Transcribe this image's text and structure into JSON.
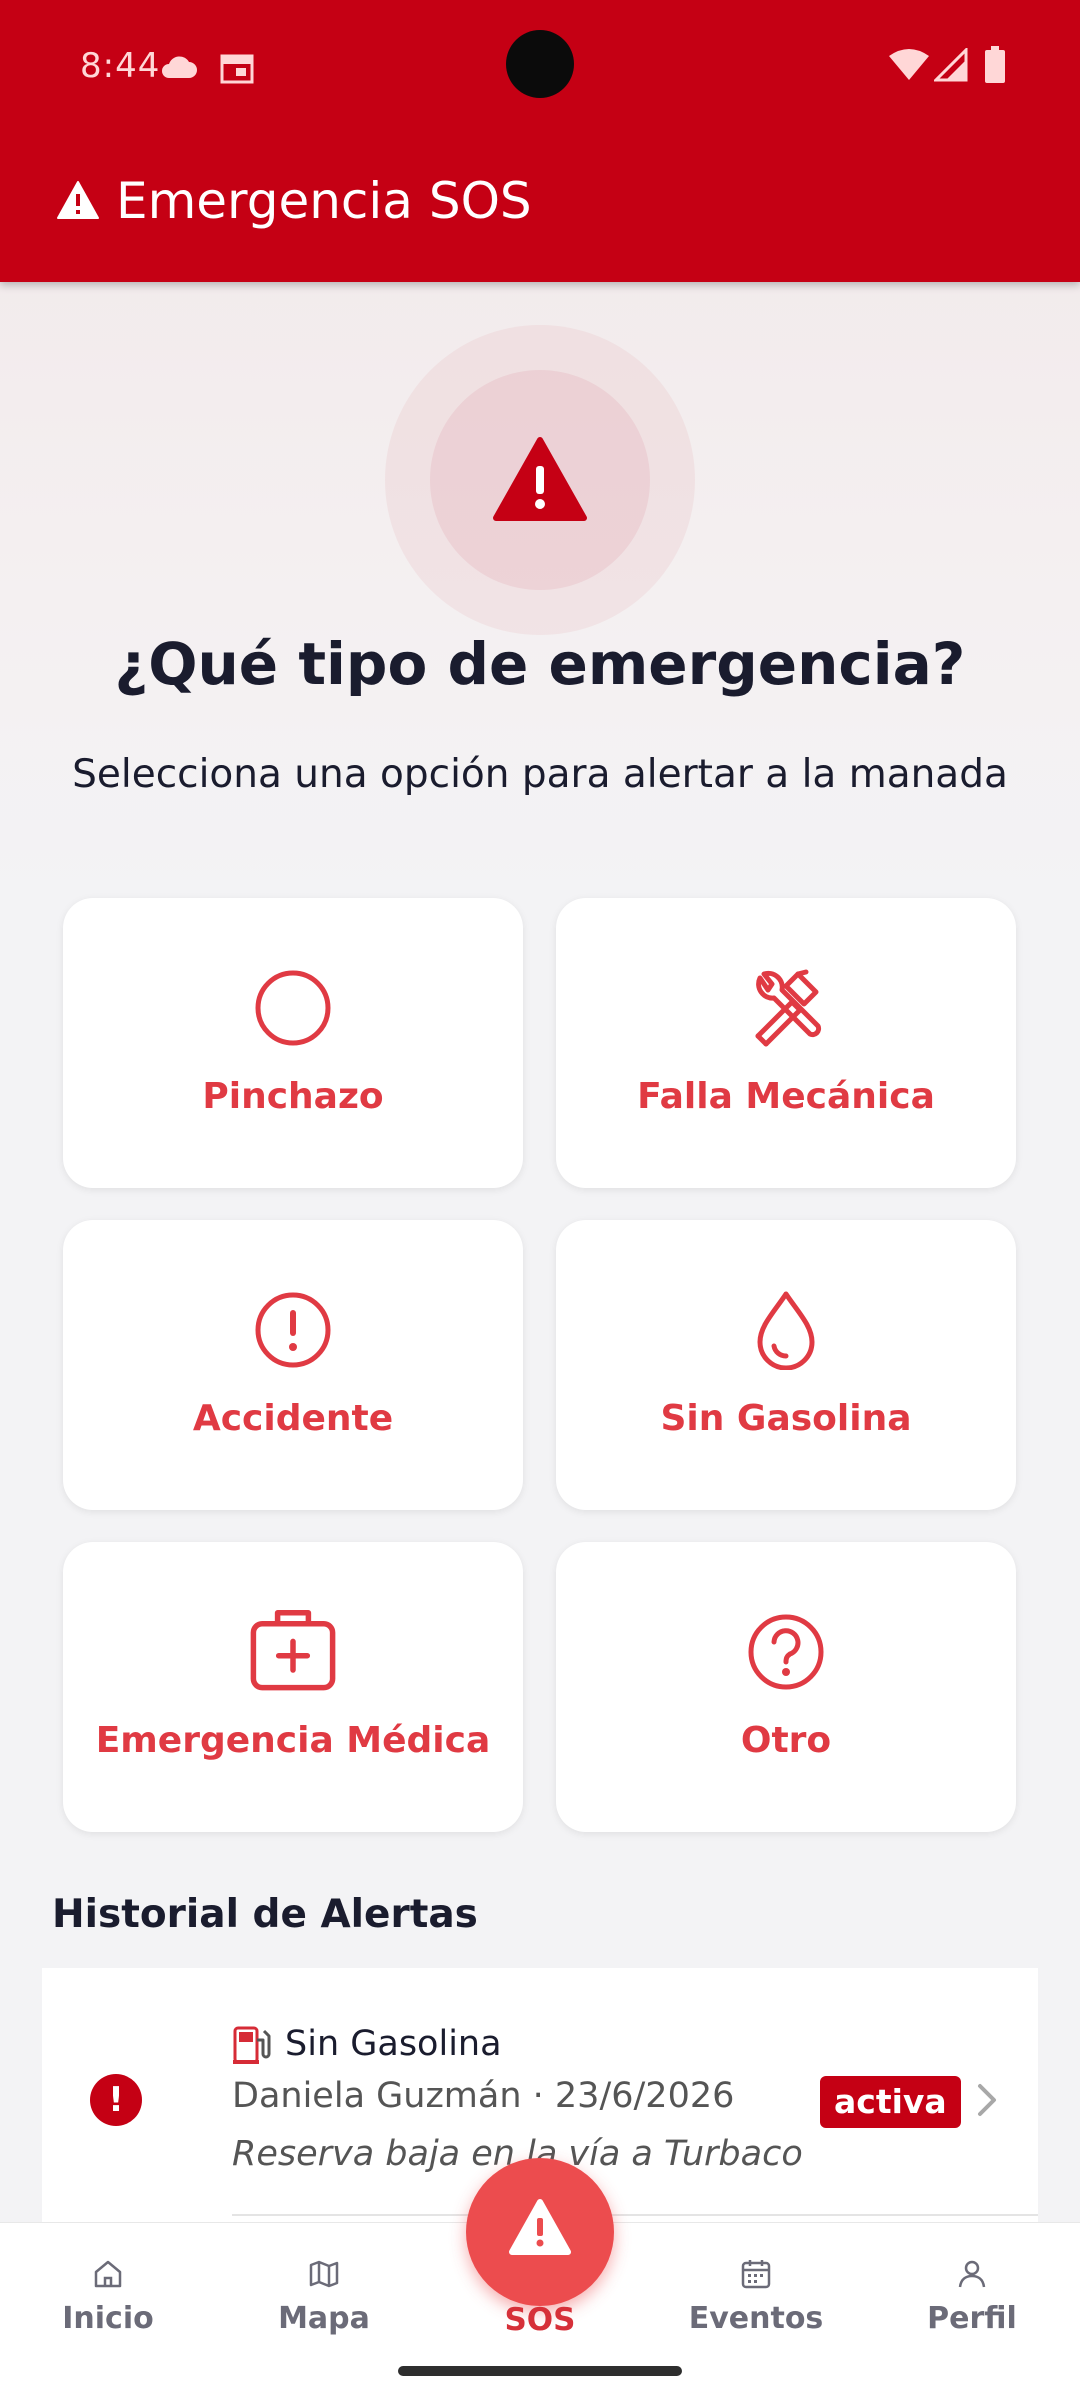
{
  "status_bar": {
    "time": "8:44",
    "left_icons": [
      "cloud-icon",
      "calendar-icon"
    ],
    "right_icons": [
      "wifi-icon",
      "signal-icon",
      "battery-icon"
    ]
  },
  "app_bar": {
    "title": "Emergencia SOS",
    "icon": "warning-icon",
    "color": "#c50014"
  },
  "hero": {
    "icon": "warning-icon",
    "title": "¿Qué tipo de emergencia?",
    "subtitle": "Selecciona una opción para alertar a la manada"
  },
  "options": [
    {
      "label": "Pinchazo",
      "icon": "circle-icon"
    },
    {
      "label": "Falla Mecánica",
      "icon": "tools-icon"
    },
    {
      "label": "Accidente",
      "icon": "alert-circle-icon"
    },
    {
      "label": "Sin Gasolina",
      "icon": "droplet-icon"
    },
    {
      "label": "Emergencia Médica",
      "icon": "first-aid-kit-icon"
    },
    {
      "label": "Otro",
      "icon": "help-circle-icon"
    }
  ],
  "accent_color": "#e03a43",
  "history": {
    "title": "Historial de Alertas",
    "items": [
      {
        "emoji": "⛽",
        "type": "Sin Gasolina",
        "meta": "Daniela Guzmán · 23/6/2026",
        "note": "Reserva baja en la vía a Turbaco",
        "status": "activa"
      }
    ]
  },
  "bottom_nav": {
    "items": [
      {
        "label": "Inicio",
        "icon": "home-icon"
      },
      {
        "label": "Mapa",
        "icon": "map-icon"
      },
      {
        "label": "SOS",
        "icon": "warning-icon"
      },
      {
        "label": "Eventos",
        "icon": "calendar-icon"
      },
      {
        "label": "Perfil",
        "icon": "user-icon"
      }
    ],
    "active": "SOS"
  }
}
